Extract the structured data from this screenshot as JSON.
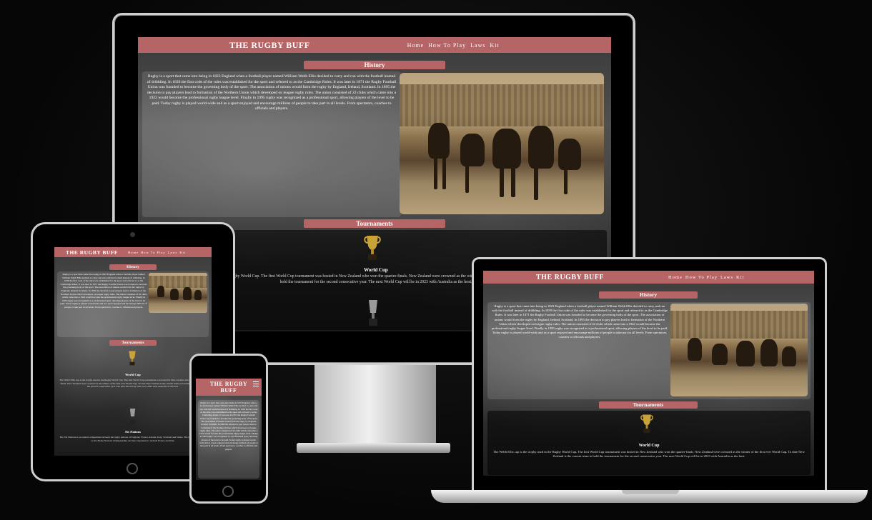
{
  "site": {
    "brand": "THE RUGBY BUFF",
    "brand_phone_line1": "THE RUGBY",
    "brand_phone_line2": "BUFF",
    "nav": [
      "Home",
      "How To Play",
      "Laws",
      "Kit"
    ],
    "history_heading": "History",
    "tournaments_heading": "Tournaments",
    "world_cup_label": "World Cup",
    "six_nations_label": "Six Nations",
    "history_text": "Rugby is a sport that came into being in 1823 England when a football player named William Webb Ellis decided to carry and run with the football instead of dribbling. In 1839 the first code of the rules was established for the sport and referred to as the Cambridge Rules. It was later in 1871 the Rugby Football Union was founded to become the governing body of the sport. The association of unions would form the rugby by England, Ireland, Scotland. In 1895 the decision to pay players lead to formation of the Northern Union which developed on league rugby rules. The union consisted of 22 clubs which came into a 1922 would become the professional rugby league level. Finally in 1995 rugby was recognized as a professional sport, allowing players of the level to be paid. Today rugby is played world-wide and as a sport enjoyed and encourage millions of people to take part in all levels. From spectators, coaches to officials and players.",
    "cup_text": "The Webb Ellis cup is the trophy used in the Rugby World Cup. The first World Cup tournament was hosted in New Zealand who won the quarter-finals. New Zealand were crowned as the winner of the first ever World Cup. To date New Zealand is the current team to hold the tournament for the second consecutive year. The next World Cup will be in 2023 with Australia as the host.",
    "six_nations_text": "The Six Nations is an annual competition between the rugby nations of England, France, Ireland, Italy, Scotland and Wales. The tournament began as the Home Nations Championship and later expanded to include France and Italy."
  },
  "colors": {
    "nav_bar": "#b56565",
    "background": "#050505"
  },
  "icons": [
    "world-cup-trophy-icon",
    "six-nations-trophy-icon",
    "hamburger-menu-icon"
  ]
}
